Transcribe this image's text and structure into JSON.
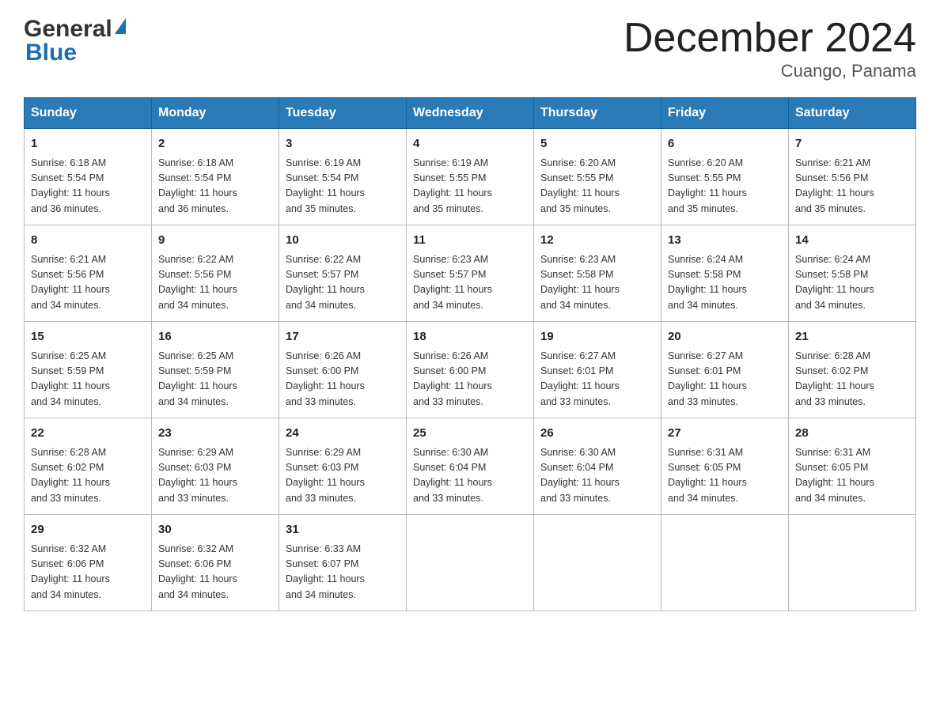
{
  "header": {
    "logo_general": "General",
    "logo_blue": "Blue",
    "title": "December 2024",
    "subtitle": "Cuango, Panama"
  },
  "calendar": {
    "days_of_week": [
      "Sunday",
      "Monday",
      "Tuesday",
      "Wednesday",
      "Thursday",
      "Friday",
      "Saturday"
    ],
    "weeks": [
      [
        {
          "day": "1",
          "sunrise": "6:18 AM",
          "sunset": "5:54 PM",
          "daylight": "11 hours and 36 minutes."
        },
        {
          "day": "2",
          "sunrise": "6:18 AM",
          "sunset": "5:54 PM",
          "daylight": "11 hours and 36 minutes."
        },
        {
          "day": "3",
          "sunrise": "6:19 AM",
          "sunset": "5:54 PM",
          "daylight": "11 hours and 35 minutes."
        },
        {
          "day": "4",
          "sunrise": "6:19 AM",
          "sunset": "5:55 PM",
          "daylight": "11 hours and 35 minutes."
        },
        {
          "day": "5",
          "sunrise": "6:20 AM",
          "sunset": "5:55 PM",
          "daylight": "11 hours and 35 minutes."
        },
        {
          "day": "6",
          "sunrise": "6:20 AM",
          "sunset": "5:55 PM",
          "daylight": "11 hours and 35 minutes."
        },
        {
          "day": "7",
          "sunrise": "6:21 AM",
          "sunset": "5:56 PM",
          "daylight": "11 hours and 35 minutes."
        }
      ],
      [
        {
          "day": "8",
          "sunrise": "6:21 AM",
          "sunset": "5:56 PM",
          "daylight": "11 hours and 34 minutes."
        },
        {
          "day": "9",
          "sunrise": "6:22 AM",
          "sunset": "5:56 PM",
          "daylight": "11 hours and 34 minutes."
        },
        {
          "day": "10",
          "sunrise": "6:22 AM",
          "sunset": "5:57 PM",
          "daylight": "11 hours and 34 minutes."
        },
        {
          "day": "11",
          "sunrise": "6:23 AM",
          "sunset": "5:57 PM",
          "daylight": "11 hours and 34 minutes."
        },
        {
          "day": "12",
          "sunrise": "6:23 AM",
          "sunset": "5:58 PM",
          "daylight": "11 hours and 34 minutes."
        },
        {
          "day": "13",
          "sunrise": "6:24 AM",
          "sunset": "5:58 PM",
          "daylight": "11 hours and 34 minutes."
        },
        {
          "day": "14",
          "sunrise": "6:24 AM",
          "sunset": "5:58 PM",
          "daylight": "11 hours and 34 minutes."
        }
      ],
      [
        {
          "day": "15",
          "sunrise": "6:25 AM",
          "sunset": "5:59 PM",
          "daylight": "11 hours and 34 minutes."
        },
        {
          "day": "16",
          "sunrise": "6:25 AM",
          "sunset": "5:59 PM",
          "daylight": "11 hours and 34 minutes."
        },
        {
          "day": "17",
          "sunrise": "6:26 AM",
          "sunset": "6:00 PM",
          "daylight": "11 hours and 33 minutes."
        },
        {
          "day": "18",
          "sunrise": "6:26 AM",
          "sunset": "6:00 PM",
          "daylight": "11 hours and 33 minutes."
        },
        {
          "day": "19",
          "sunrise": "6:27 AM",
          "sunset": "6:01 PM",
          "daylight": "11 hours and 33 minutes."
        },
        {
          "day": "20",
          "sunrise": "6:27 AM",
          "sunset": "6:01 PM",
          "daylight": "11 hours and 33 minutes."
        },
        {
          "day": "21",
          "sunrise": "6:28 AM",
          "sunset": "6:02 PM",
          "daylight": "11 hours and 33 minutes."
        }
      ],
      [
        {
          "day": "22",
          "sunrise": "6:28 AM",
          "sunset": "6:02 PM",
          "daylight": "11 hours and 33 minutes."
        },
        {
          "day": "23",
          "sunrise": "6:29 AM",
          "sunset": "6:03 PM",
          "daylight": "11 hours and 33 minutes."
        },
        {
          "day": "24",
          "sunrise": "6:29 AM",
          "sunset": "6:03 PM",
          "daylight": "11 hours and 33 minutes."
        },
        {
          "day": "25",
          "sunrise": "6:30 AM",
          "sunset": "6:04 PM",
          "daylight": "11 hours and 33 minutes."
        },
        {
          "day": "26",
          "sunrise": "6:30 AM",
          "sunset": "6:04 PM",
          "daylight": "11 hours and 33 minutes."
        },
        {
          "day": "27",
          "sunrise": "6:31 AM",
          "sunset": "6:05 PM",
          "daylight": "11 hours and 34 minutes."
        },
        {
          "day": "28",
          "sunrise": "6:31 AM",
          "sunset": "6:05 PM",
          "daylight": "11 hours and 34 minutes."
        }
      ],
      [
        {
          "day": "29",
          "sunrise": "6:32 AM",
          "sunset": "6:06 PM",
          "daylight": "11 hours and 34 minutes."
        },
        {
          "day": "30",
          "sunrise": "6:32 AM",
          "sunset": "6:06 PM",
          "daylight": "11 hours and 34 minutes."
        },
        {
          "day": "31",
          "sunrise": "6:33 AM",
          "sunset": "6:07 PM",
          "daylight": "11 hours and 34 minutes."
        },
        null,
        null,
        null,
        null
      ]
    ],
    "labels": {
      "sunrise": "Sunrise:",
      "sunset": "Sunset:",
      "daylight": "Daylight:"
    }
  }
}
